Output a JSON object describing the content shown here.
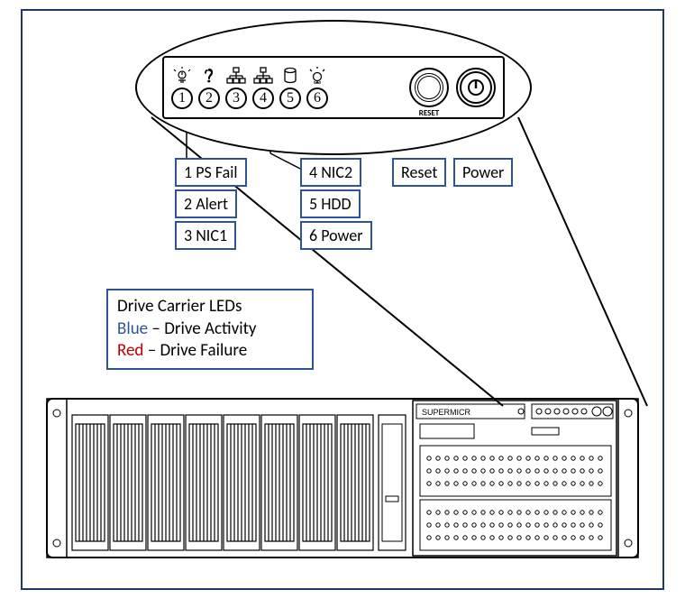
{
  "panel": {
    "leds": [
      {
        "num": "1",
        "icon": "ps-fail-icon"
      },
      {
        "num": "2",
        "icon": "info-icon"
      },
      {
        "num": "3",
        "icon": "nic1-icon"
      },
      {
        "num": "4",
        "icon": "nic2-icon"
      },
      {
        "num": "5",
        "icon": "hdd-icon"
      },
      {
        "num": "6",
        "icon": "power-led-icon"
      }
    ],
    "reset_label": "RESET"
  },
  "labels": {
    "l1": "1 PS Fail",
    "l2": "2 Alert",
    "l3": "3 NIC1",
    "l4": "4 NIC2",
    "l5": "5 HDD",
    "l6": "6 Power",
    "reset": "Reset",
    "power": "Power"
  },
  "legend": {
    "title": "Drive Carrier LEDs",
    "line_blue_a": "Blue",
    "line_blue_b": " – Drive Activity",
    "line_red_a": "Red",
    "line_red_b": " – Drive Failure"
  },
  "brand": "SUPERMICRO"
}
